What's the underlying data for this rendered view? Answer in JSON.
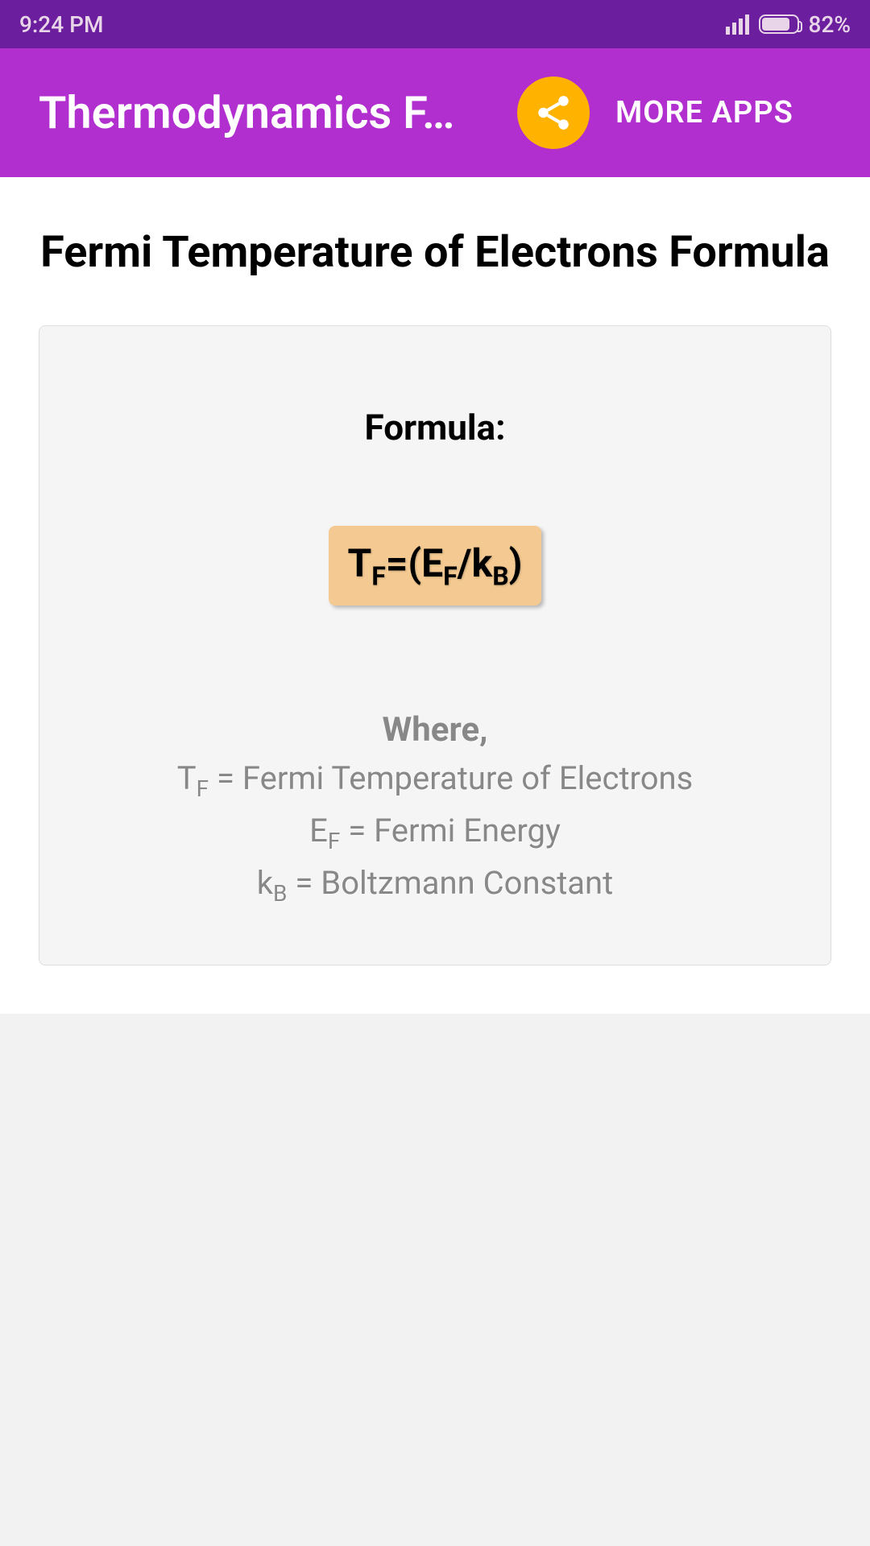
{
  "statusBar": {
    "time": "9:24 PM",
    "batteryPercent": "82%"
  },
  "appBar": {
    "title": "Thermodynamics F…",
    "moreApps": "MORE APPS"
  },
  "content": {
    "pageTitle": "Fermi Temperature of Electrons Formula",
    "formulaLabel": "Formula:",
    "formula": {
      "var1": "T",
      "sub1": "F",
      "eq": "=(E",
      "sub2": "F",
      "mid": "/k",
      "sub3": "B",
      "close": ")"
    },
    "whereLabel": "Where,",
    "definitions": [
      {
        "var": "T",
        "sub": "F",
        "desc": " = Fermi Temperature of Electrons"
      },
      {
        "var": "E",
        "sub": "F",
        "desc": " = Fermi Energy"
      },
      {
        "var": "k",
        "sub": "B",
        "desc": " = Boltzmann Constant"
      }
    ]
  }
}
